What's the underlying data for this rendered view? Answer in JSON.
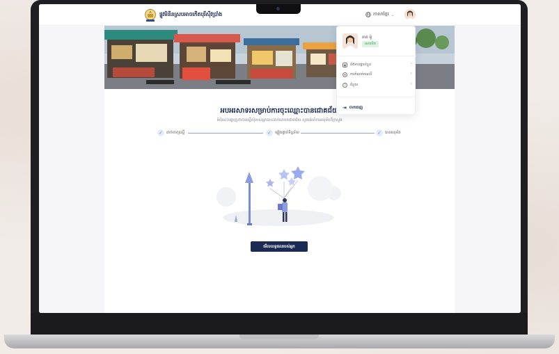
{
  "brand": {
    "name": "ផ្លូវមិនីនស្របអាចកើតបុរីស៊ីវប្រាំង"
  },
  "nav": {
    "language": "ភាសាខ្មែរ"
  },
  "menu": {
    "user_name": "ភាព ម៉ូ",
    "badge": "អេចរមិត",
    "items": [
      {
        "label": "ព័ត៌មានផ្ទាល់ខ្លួន",
        "icon": "profile-icon"
      },
      {
        "label": "ការកំណត់គណនី",
        "icon": "settings-icon"
      },
      {
        "label": "ជំនួយ",
        "icon": "help-icon"
      }
    ],
    "logout": "ចាកចេញ"
  },
  "main": {
    "title": "អបអរសាទរសម្រាប់ការចុះឈ្មោះបានជោគជ័យ",
    "subtitle": "ទំព័រនេះបង្ហាញថាការស្នើសុំរបស់អ្នកបានដាក់ដោយជោគជ័យ សូមរង់ចាំការអនុម័តពីក្រសួង",
    "steps": [
      {
        "label": "ដាក់ពាក្យស្នើ"
      },
      {
        "label": "ផ្ទៀងផ្ទាត់ទិន្នន័យ"
      },
      {
        "label": "បានអនុម័ត"
      }
    ],
    "cta": "មើលលទ្ធផលរបស់អ្នក"
  },
  "colors": {
    "primary": "#1b2a52",
    "accent": "#8aa0e8",
    "badge_bg": "#dff3e4",
    "badge_text": "#3aa55c"
  }
}
